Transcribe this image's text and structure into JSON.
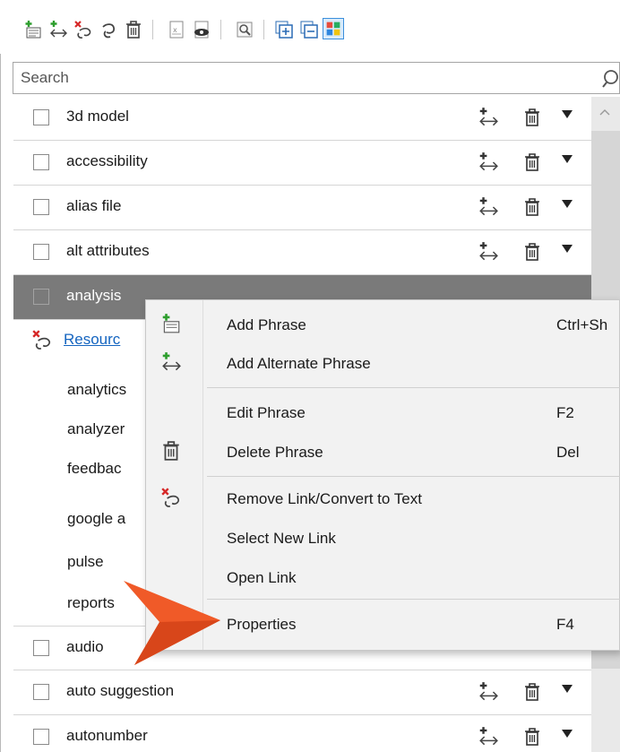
{
  "toolbar": {
    "buttons": [
      {
        "name": "add-phrase-icon"
      },
      {
        "name": "add-alternate-phrase-icon"
      },
      {
        "name": "remove-link-icon"
      },
      {
        "name": "link-icon"
      },
      {
        "name": "delete-icon"
      },
      {
        "name": "text-document-icon"
      },
      {
        "name": "preview-icon"
      },
      {
        "name": "properties-icon"
      },
      {
        "name": "expand-all-icon"
      },
      {
        "name": "collapse-all-icon"
      },
      {
        "name": "color-grid-icon"
      }
    ]
  },
  "search": {
    "placeholder": "Search",
    "value": ""
  },
  "rows": [
    {
      "label": "3d model"
    },
    {
      "label": "accessibility"
    },
    {
      "label": "alias file"
    },
    {
      "label": "alt attributes"
    },
    {
      "label": "analysis"
    }
  ],
  "subitems": {
    "link": "Resourc",
    "items": [
      "analytics",
      "analyzer",
      "feedbac",
      "google a",
      "pulse",
      "reports"
    ]
  },
  "rows_after": [
    {
      "label": "audio"
    },
    {
      "label": "auto suggestion"
    },
    {
      "label": "autonumber"
    }
  ],
  "context_menu": {
    "items": [
      {
        "label": "Add Phrase",
        "shortcut": "Ctrl+Sh",
        "icon": "add-phrase-icon"
      },
      {
        "label": "Add Alternate Phrase",
        "shortcut": "",
        "icon": "add-alternate-phrase-icon"
      },
      {
        "label": "Edit Phrase",
        "shortcut": "F2",
        "icon": ""
      },
      {
        "label": "Delete Phrase",
        "shortcut": "Del",
        "icon": "delete-icon"
      },
      {
        "label": "Remove Link/Convert to Text",
        "shortcut": "",
        "icon": "remove-link-icon"
      },
      {
        "label": "Select New Link",
        "shortcut": "",
        "icon": ""
      },
      {
        "label": "Open Link",
        "shortcut": "",
        "icon": ""
      },
      {
        "label": "Properties",
        "shortcut": "F4",
        "icon": ""
      }
    ]
  },
  "colors": {
    "selected_row": "#7a7a7a",
    "link": "#1565c0",
    "callout_arrow": "#f05a28",
    "add_green": "#2e9e2e",
    "remove_red": "#d62828"
  }
}
